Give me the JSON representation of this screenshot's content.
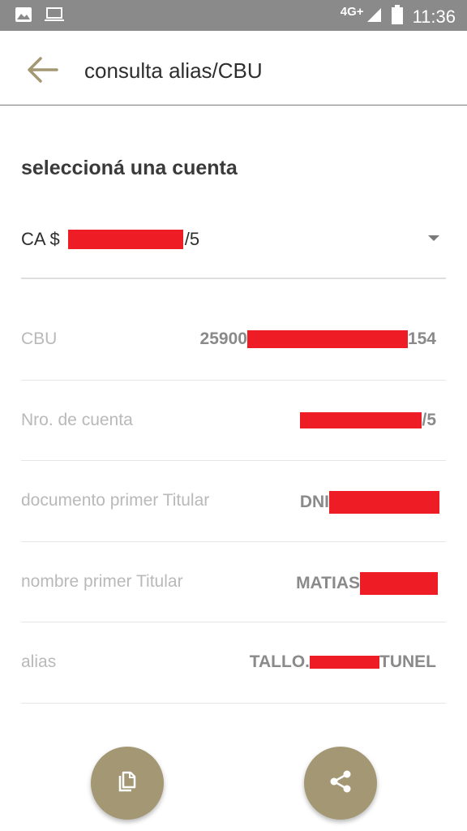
{
  "status_bar": {
    "network": "4G+",
    "time": "11:36",
    "icons": [
      "image-icon",
      "laptop-icon",
      "signal-icon",
      "battery-icon"
    ]
  },
  "app_bar": {
    "title": "consulta alias/CBU",
    "back_icon": "arrow-left-icon"
  },
  "section_title": "seleccioná una cuenta",
  "account_select": {
    "prefix": "CA $",
    "suffix": "/5",
    "redacted": true
  },
  "info_rows": [
    {
      "label": "CBU",
      "value_before": "25900",
      "value_after": "154",
      "redacted": true
    },
    {
      "label": "Nro. de cuenta",
      "value_before": "",
      "value_after": "/5",
      "redacted": true
    },
    {
      "label": "documento primer Titular",
      "value_before": "DNI",
      "value_after": "",
      "redacted": true
    },
    {
      "label": "nombre primer Titular",
      "value_before": "MATIAS",
      "value_after": "",
      "redacted": true
    },
    {
      "label": "alias",
      "value_before": "TALLO.",
      "value_after": "TUNEL",
      "redacted": true
    }
  ],
  "fabs": [
    {
      "icon": "copy-icon"
    },
    {
      "icon": "share-icon"
    }
  ],
  "colors": {
    "accent": "#a39873",
    "status_bar": "#8a8a8a",
    "redaction": "#ee1c25",
    "label": "#b9b9b9",
    "value": "#8a8a8a"
  }
}
